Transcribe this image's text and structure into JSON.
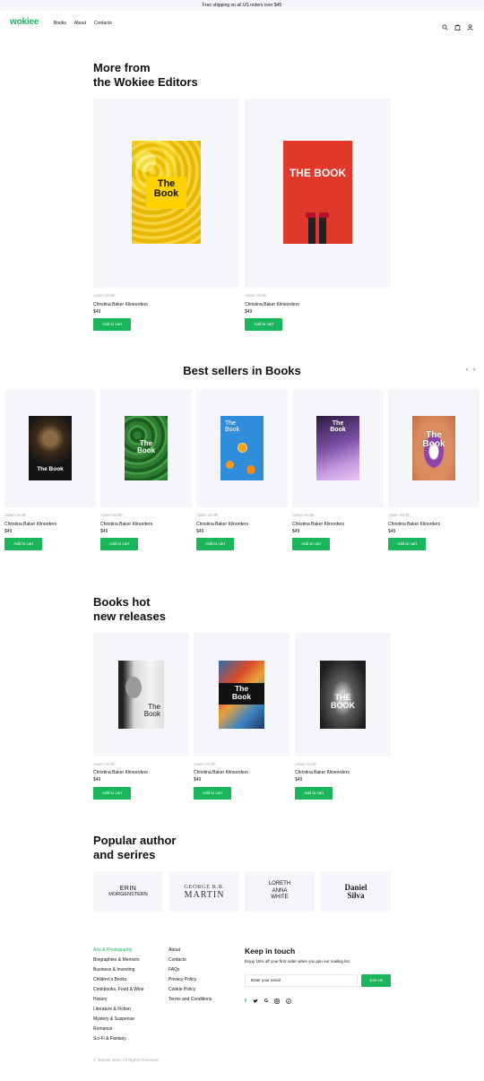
{
  "topbar": {
    "text": "Free shipping on all US orders over $49"
  },
  "header": {
    "logo": "wokiee",
    "nav": [
      "Books",
      "About",
      "Contacts"
    ],
    "icons": [
      "search-icon",
      "bag-icon",
      "user-icon"
    ]
  },
  "editors": {
    "title_line1": "More from",
    "title_line2": "the Wokiee Editors",
    "items": [
      {
        "cover_text": "The Book",
        "author": "Adam Smith",
        "title": "Christina Baker Klineorders",
        "price": "$49",
        "button": "Add to cart"
      },
      {
        "cover_text": "THE BOOK",
        "author": "Adam Smith",
        "title": "Christina Baker Klineorders",
        "price": "$49",
        "button": "Add to cart"
      }
    ]
  },
  "bestsellers": {
    "title": "Best sellers in Books",
    "items": [
      {
        "cover_text": "The Book",
        "author": "Adam Smith",
        "title": "Christina Baker Klinorders",
        "price": "$49",
        "button": "Add to cart"
      },
      {
        "cover_text": "The Book",
        "author": "Adam Smith",
        "title": "Christina Baker Klinorders",
        "price": "$49",
        "button": "Add to cart"
      },
      {
        "cover_text": "The Book",
        "author": "Adam Smith",
        "title": "Christina Baker Klinorders",
        "price": "$49",
        "button": "Add to cart"
      },
      {
        "cover_text": "The Book",
        "author": "Adam Smith",
        "title": "Christina Baker Klinorders",
        "price": "$49",
        "button": "Add to cart"
      },
      {
        "cover_text": "The Book",
        "author": "Adam Smith",
        "title": "Christina Baker Klinorders",
        "price": "$49",
        "button": "Add to cart"
      }
    ]
  },
  "new_releases": {
    "title_line1": "Books hot",
    "title_line2": "new releases",
    "items": [
      {
        "cover_text": "The Book",
        "author": "Adam Smith",
        "title": "Christina Baker Klineorders",
        "price": "$49",
        "button": "Add to cart"
      },
      {
        "cover_text": "The Book",
        "author": "Adam Smith",
        "title": "Christina Baker Klineorders",
        "price": "$49",
        "button": "Add to cart"
      },
      {
        "cover_text": "THE BOOK",
        "author": "Adam Smith",
        "title": "Christina Baker Klineorders",
        "price": "$49",
        "button": "Add to cart"
      }
    ]
  },
  "authors": {
    "title_line1": "Popular author",
    "title_line2": "and serires",
    "items": [
      {
        "line1": "ERIN",
        "line2": "MORGENSTERN",
        "line3": ""
      },
      {
        "line1": "GEORGE R.R.",
        "line2": "MARTIN",
        "line3": ""
      },
      {
        "line1": "LORETH",
        "line2": "ANNA",
        "line3": "WHITE"
      },
      {
        "line1": "Daniel",
        "line2": "Silva",
        "line3": ""
      }
    ]
  },
  "footer": {
    "categories": [
      "Arts & Photography",
      "Biographies & Memoirs",
      "Business & Investing",
      "Children's Books",
      "Cookbooks, Food & Wine",
      "History",
      "Literature & Fiction",
      "Mystery & Suspense",
      "Romance",
      "Sci-Fi & Fantasy"
    ],
    "links": [
      "About",
      "Contacts",
      "FAQs",
      "Privacy Policy",
      "Cookie Policy",
      "Terms and Conditions"
    ],
    "keep_title": "Keep in touch",
    "keep_sub": "Enjoy 15% off your first order when you join our mailing list.",
    "email_placeholder": "Enter your email",
    "join": "Join Us",
    "social": [
      "facebook-icon",
      "twitter-icon",
      "google-icon",
      "instagram-icon",
      "pinterest-icon"
    ],
    "copyright": "© Wokiee 2019. All Rights Reserved"
  },
  "colors": {
    "accent": "#1bb55c",
    "card_bg": "#f4f6fa"
  }
}
